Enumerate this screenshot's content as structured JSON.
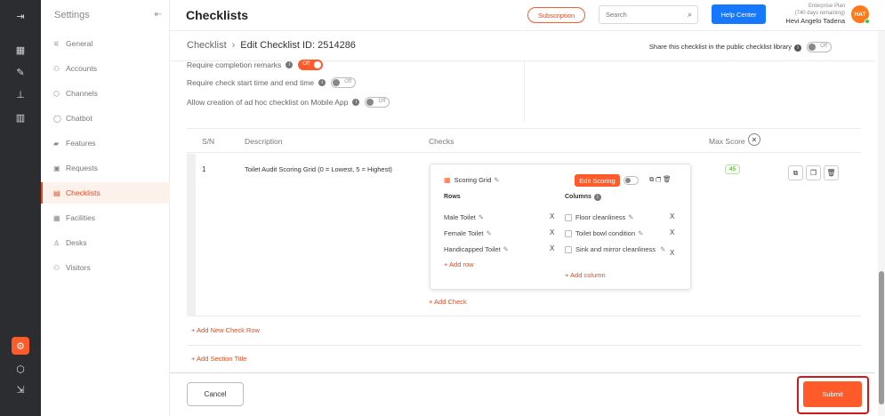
{
  "rail": {
    "icons": [
      "collapse-icon",
      "dashboard-icon",
      "cleaning-icon",
      "hierarchy-icon",
      "analytics-icon",
      "settings-icon",
      "cube-icon",
      "logout-icon"
    ]
  },
  "sidebar": {
    "title": "Settings",
    "items": [
      {
        "label": "General",
        "icon": "sliders-icon",
        "glyph": "⚙"
      },
      {
        "label": "Accounts",
        "icon": "users-icon",
        "glyph": "👥"
      },
      {
        "label": "Channels",
        "icon": "cube-icon",
        "glyph": "◈"
      },
      {
        "label": "Chatbot",
        "icon": "chat-icon",
        "glyph": "◯"
      },
      {
        "label": "Features",
        "icon": "features-icon",
        "glyph": "▰"
      },
      {
        "label": "Requests",
        "icon": "requests-icon",
        "glyph": "▣"
      },
      {
        "label": "Checklists",
        "icon": "checklist-icon",
        "glyph": "▤"
      },
      {
        "label": "Facilities",
        "icon": "facilities-icon",
        "glyph": "▦"
      },
      {
        "label": "Desks",
        "icon": "desk-icon",
        "glyph": "⚇"
      },
      {
        "label": "Visitors",
        "icon": "visitors-icon",
        "glyph": "👤"
      }
    ],
    "active_index": 6
  },
  "header": {
    "title": "Checklists",
    "subscription_label": "Subscription",
    "search_placeholder": "Search",
    "help_label": "Help Center",
    "plan_name": "Enterprise Plan",
    "plan_days": "(740 days remaining)",
    "user_name": "Hevi Angelo Tadena",
    "avatar_initials": "HAT"
  },
  "breadcrumb": {
    "root": "Checklist",
    "current": "Edit Checklist ID: 2514286"
  },
  "share": {
    "label": "Share this checklist in the public checklist library",
    "toggle": "Off"
  },
  "options": [
    {
      "label": "Require completion remarks",
      "toggle": "Off",
      "on": true
    },
    {
      "label": "Require check start time and end time",
      "toggle": "Off",
      "on": false
    },
    {
      "label": "Allow creation of ad hoc checklist on Mobile App",
      "toggle": "Off",
      "on": false
    }
  ],
  "table": {
    "headers": {
      "sn": "S/N",
      "description": "Description",
      "checks": "Checks",
      "max_score": "Max Score"
    },
    "rows": [
      {
        "sn": "1",
        "description": "Toilet Audit Scoring Grid (0 = Lowest, 5 = Highest)",
        "max_score": "45",
        "grid": {
          "title": "Scoring Grid",
          "edit_scoring_label": "Edit Scoring",
          "rows_header": "Rows",
          "columns_header": "Columns",
          "rows": [
            "Male Toilet",
            "Female Toilet",
            "Handicapped Toilet"
          ],
          "columns": [
            "Floor cleanliness",
            "Toilet bowl condition",
            "Sink and mirror cleanliness"
          ],
          "add_row_label": "+ Add row",
          "add_column_label": "+ Add column"
        },
        "add_check_label": "+ Add Check"
      }
    ]
  },
  "add_new_check_row_label": "+ Add New Check Row",
  "add_section_title_label": "+ Add Section Title",
  "footer": {
    "cancel_label": "Cancel",
    "submit_label": "Submit"
  },
  "colors": {
    "accent": "#ff5a2a",
    "primary_blue": "#1677ff",
    "rail_bg": "#2b2d31",
    "score_green": "#4aa227",
    "highlight_red": "#d01818"
  }
}
